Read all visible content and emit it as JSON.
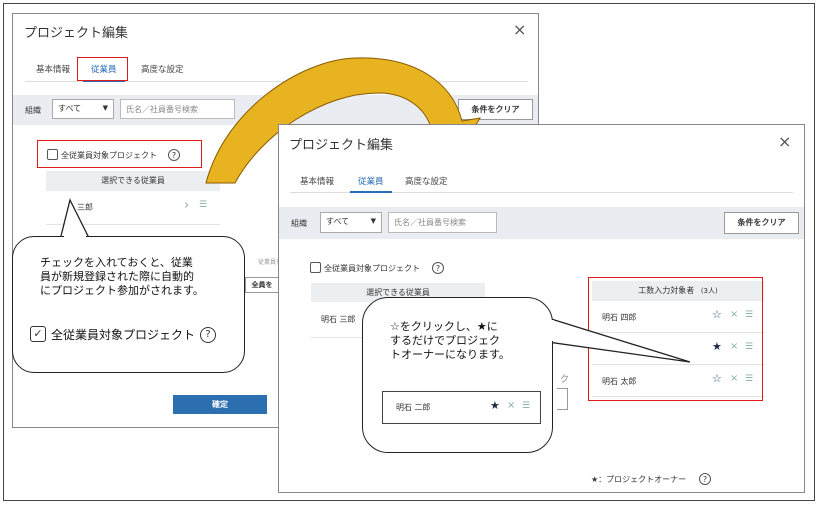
{
  "dialog": {
    "title": "プロジェクト編集",
    "close_icon": "×",
    "tabs": [
      {
        "label": "基本情報"
      },
      {
        "label": "従業員"
      },
      {
        "label": "高度な設定"
      }
    ],
    "filter": {
      "org_label": "組織",
      "org_value": "すべて",
      "search_placeholder": "氏名／社員番号検索",
      "clear_button": "条件をクリア"
    },
    "all_employees_label": "全従業員対象プロジェクト",
    "help_icon": "?",
    "selectable_header": "選択できる従業員",
    "confirm_button": "確定"
  },
  "back_dialog": {
    "selectable_row": "三郎",
    "partial_text_1": "従業員を",
    "partial_button": "全員を"
  },
  "front_dialog": {
    "selectable_row": "明石 三郎",
    "assigned_header": "工数入力対象者",
    "assigned_count": "(3人)",
    "assigned_rows": [
      {
        "name": "明石 四郎",
        "owner": false
      },
      {
        "name": "",
        "owner": true
      },
      {
        "name": "明石 太郎",
        "owner": false
      }
    ],
    "partial_char": "ク",
    "legend_star": "★",
    "legend_text": "：プロジェクトオーナー"
  },
  "callout_left": {
    "lines": [
      "チェックを入れておくと、従業",
      "員が新規登録された際に自動的",
      "にプロジェクト参加がされます。"
    ],
    "checkbox_label": "全従業員対象プロジェクト",
    "check_mark": "✓",
    "help_icon": "?"
  },
  "callout_right": {
    "lines": [
      "☆をクリックし、★に",
      "するだけでプロジェク",
      "トオーナーになります。"
    ],
    "example_name": "明石 二郎"
  },
  "icons": {
    "star_empty": "☆",
    "star_filled": "★",
    "remove": "×",
    "drag": "☰",
    "chevron": "›"
  },
  "colors": {
    "accent": "#2a6ebb",
    "highlight_red": "#e01818",
    "arrow_gold": "#e8b320",
    "primary_button": "#2c6fb1"
  }
}
